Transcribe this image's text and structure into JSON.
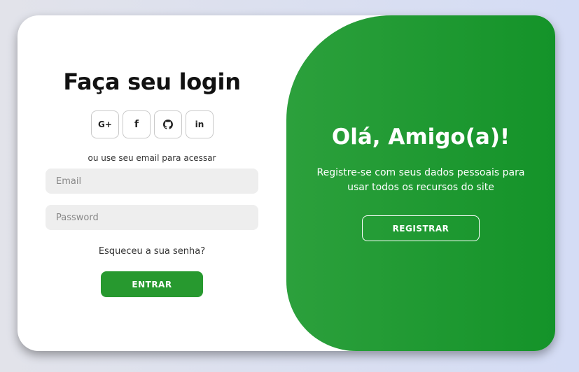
{
  "login": {
    "title": "Faça seu login",
    "socials": [
      {
        "label": "G+",
        "icon": "google-plus-icon"
      },
      {
        "label": "f",
        "icon": "facebook-icon"
      },
      {
        "label": "",
        "icon": "github-icon"
      },
      {
        "label": "in",
        "icon": "linkedin-icon"
      }
    ],
    "alt_text": "ou use seu email para acessar",
    "email_placeholder": "Email",
    "password_placeholder": "Password",
    "forgot_label": "Esqueceu a sua senha?",
    "submit_label": "ENTRAR"
  },
  "panel": {
    "title": "Olá, Amigo(a)!",
    "text": "Registre-se com seus dados pessoais para usar todos os recursos do site",
    "button_label": "REGISTRAR"
  },
  "colors": {
    "accent": "#27992f",
    "panel_start": "#2ca03c",
    "panel_end": "#149329"
  }
}
